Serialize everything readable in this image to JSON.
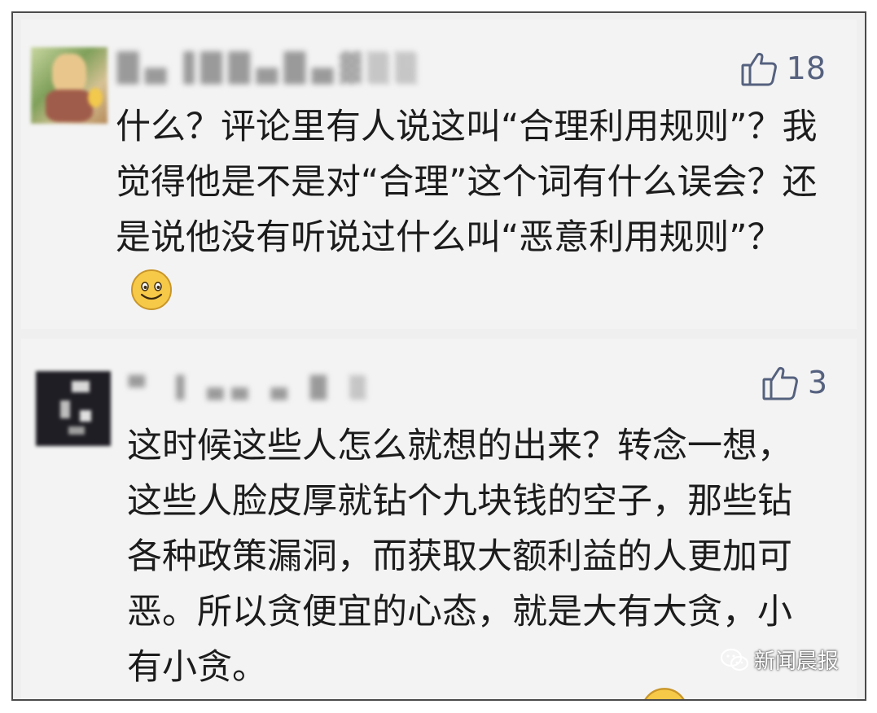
{
  "comments": [
    {
      "username": "█▄▐██▄█▄▓▒▒",
      "likes": "18",
      "text": "什么？评论里有人说这叫“合理利用规则”？我觉得他是不是对“合理”这个词有什么误会？还是说他没有听说过什么叫“恶意利用规则”？",
      "has_emoji": true
    },
    {
      "username": "▀ ▐ ▄▄ ▄ █ ▒",
      "likes": "3",
      "text": "这时候这些人怎么就想的出来？转念一想，这些人脸皮厚就钻个九块钱的空子，那些钻各种政策漏洞，而获取大额利益的人更加可恶。所以贪便宜的心态，就是大有大贪，小有小贪。"
    }
  ],
  "watermark": {
    "label": "新闻晨报",
    "icon": "wechat-icon"
  },
  "icons": {
    "like": "thumbs-up-icon",
    "emoji": "smiley-emoji-icon"
  },
  "colors": {
    "like": "#55617e",
    "card_bg": "#f3f3f3",
    "text": "#1c1c1c",
    "emoji_face": "#f7c948"
  }
}
